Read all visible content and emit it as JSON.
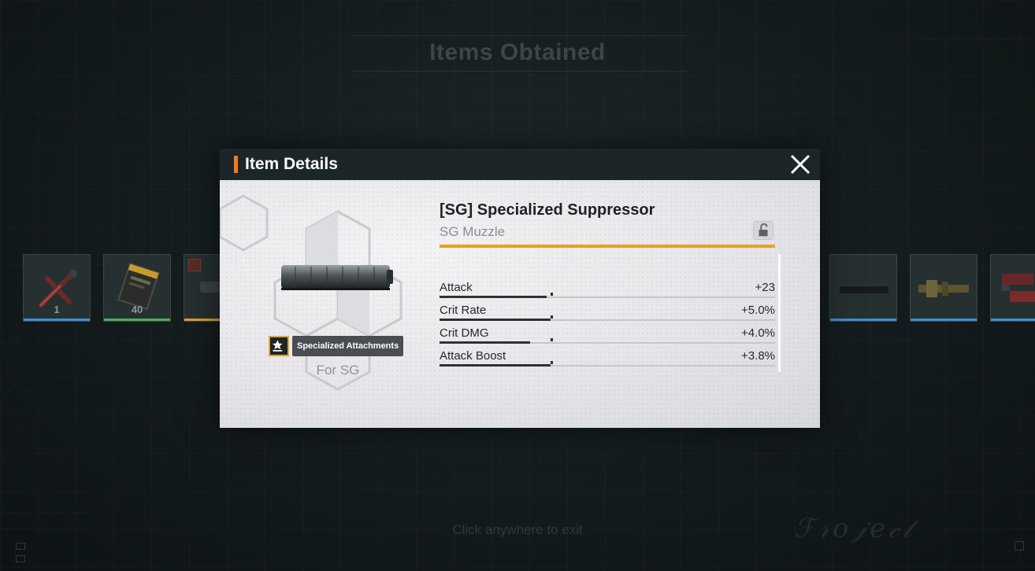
{
  "screen": {
    "title": "Items Obtained",
    "exit_hint": "Click anywhere to exit"
  },
  "slots": [
    {
      "quantity": "1",
      "rarity_color": "#3d8fd1",
      "art": "weapon-parts"
    },
    {
      "quantity": "40",
      "rarity_color": "#4caf50",
      "art": "ammo-box"
    },
    {
      "quantity": "",
      "rarity_color": "#e29a2e",
      "art": "suppressor"
    },
    {
      "quantity": "",
      "rarity_color": "#3d8fd1",
      "art": "barrel"
    },
    {
      "quantity": "",
      "rarity_color": "#3d8fd1",
      "art": "muzzle-brake"
    },
    {
      "quantity": "",
      "rarity_color": "#3d8fd1",
      "art": "red-part"
    }
  ],
  "modal": {
    "title": "Item Details",
    "accent_color": "#f07a1e",
    "item_name": "[SG] Specialized Suppressor",
    "item_type": "SG Muzzle",
    "type_underline_color": "#e8a020",
    "tag_label": "Specialized Attachments",
    "for_label": "For SG",
    "stats": [
      {
        "label": "Attack",
        "value": "+23",
        "fill": 0.32
      },
      {
        "label": "Crit Rate",
        "value": "+5.0%",
        "fill": 0.33
      },
      {
        "label": "Crit DMG",
        "value": "+4.0%",
        "fill": 0.27
      },
      {
        "label": "Attack Boost",
        "value": "+3.8%",
        "fill": 0.33
      }
    ]
  },
  "icons": {
    "close": "close-icon",
    "lock": "unlock-icon",
    "tag": "star-badge-icon"
  }
}
